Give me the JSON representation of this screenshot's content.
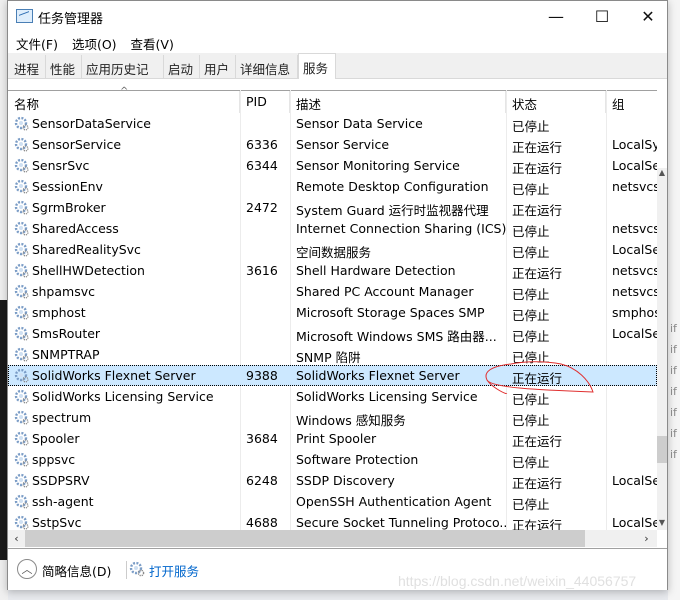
{
  "window": {
    "title": "任务管理器",
    "controls": {
      "minimize": "—",
      "maximize": "☐",
      "close": "✕"
    }
  },
  "menu": [
    "文件(F)",
    "选项(O)",
    "查看(V)"
  ],
  "tabs": [
    {
      "label": "进程",
      "active": false
    },
    {
      "label": "性能",
      "active": false
    },
    {
      "label": "应用历史记录",
      "active": false
    },
    {
      "label": "启动",
      "active": false
    },
    {
      "label": "用户",
      "active": false
    },
    {
      "label": "详细信息",
      "active": false
    },
    {
      "label": "服务",
      "active": true
    }
  ],
  "columns": {
    "name": "名称",
    "pid": "PID",
    "desc": "描述",
    "status": "状态",
    "group": "组",
    "sort_indicator": "^"
  },
  "services": [
    {
      "name": "SensorDataService",
      "pid": "",
      "desc": "Sensor Data Service",
      "status": "已停止",
      "group": ""
    },
    {
      "name": "SensorService",
      "pid": "6336",
      "desc": "Sensor Service",
      "status": "正在运行",
      "group": "LocalSy"
    },
    {
      "name": "SensrSvc",
      "pid": "6344",
      "desc": "Sensor Monitoring Service",
      "status": "正在运行",
      "group": "LocalSe"
    },
    {
      "name": "SessionEnv",
      "pid": "",
      "desc": "Remote Desktop Configuration",
      "status": "已停止",
      "group": "netsvcs"
    },
    {
      "name": "SgrmBroker",
      "pid": "2472",
      "desc": "System Guard 运行时监视器代理",
      "status": "正在运行",
      "group": ""
    },
    {
      "name": "SharedAccess",
      "pid": "",
      "desc": "Internet Connection Sharing (ICS)",
      "status": "已停止",
      "group": "netsvcs"
    },
    {
      "name": "SharedRealitySvc",
      "pid": "",
      "desc": "空间数据服务",
      "status": "已停止",
      "group": "LocalSe"
    },
    {
      "name": "ShellHWDetection",
      "pid": "3616",
      "desc": "Shell Hardware Detection",
      "status": "正在运行",
      "group": "netsvcs"
    },
    {
      "name": "shpamsvc",
      "pid": "",
      "desc": "Shared PC Account Manager",
      "status": "已停止",
      "group": "netsvcs"
    },
    {
      "name": "smphost",
      "pid": "",
      "desc": "Microsoft Storage Spaces SMP",
      "status": "已停止",
      "group": "smphos"
    },
    {
      "name": "SmsRouter",
      "pid": "",
      "desc": "Microsoft Windows SMS 路由器...",
      "status": "已停止",
      "group": "LocalSe"
    },
    {
      "name": "SNMPTRAP",
      "pid": "",
      "desc": "SNMP 陷阱",
      "status": "已停止",
      "group": ""
    },
    {
      "name": "SolidWorks Flexnet Server",
      "pid": "9388",
      "desc": "SolidWorks Flexnet Server",
      "status": "正在运行",
      "group": "",
      "selected": true
    },
    {
      "name": "SolidWorks Licensing Service",
      "pid": "",
      "desc": "SolidWorks Licensing Service",
      "status": "已停止",
      "group": ""
    },
    {
      "name": "spectrum",
      "pid": "",
      "desc": "Windows 感知服务",
      "status": "已停止",
      "group": ""
    },
    {
      "name": "Spooler",
      "pid": "3684",
      "desc": "Print Spooler",
      "status": "正在运行",
      "group": ""
    },
    {
      "name": "sppsvc",
      "pid": "",
      "desc": "Software Protection",
      "status": "已停止",
      "group": ""
    },
    {
      "name": "SSDPSRV",
      "pid": "6248",
      "desc": "SSDP Discovery",
      "status": "正在运行",
      "group": "LocalSe"
    },
    {
      "name": "ssh-agent",
      "pid": "",
      "desc": "OpenSSH Authentication Agent",
      "status": "已停止",
      "group": ""
    },
    {
      "name": "SstpSvc",
      "pid": "4688",
      "desc": "Secure Socket Tunneling Protoco...",
      "status": "正在运行",
      "group": "LocalSe"
    }
  ],
  "footer": {
    "toggle_label": "简略信息(D)",
    "open_services": "打开服务"
  },
  "watermark": "https://blog.csdn.net/weixin_44056757",
  "annotation_color": "#e03030",
  "selection_color": "#cce8ff",
  "link_color": "#0066cc"
}
